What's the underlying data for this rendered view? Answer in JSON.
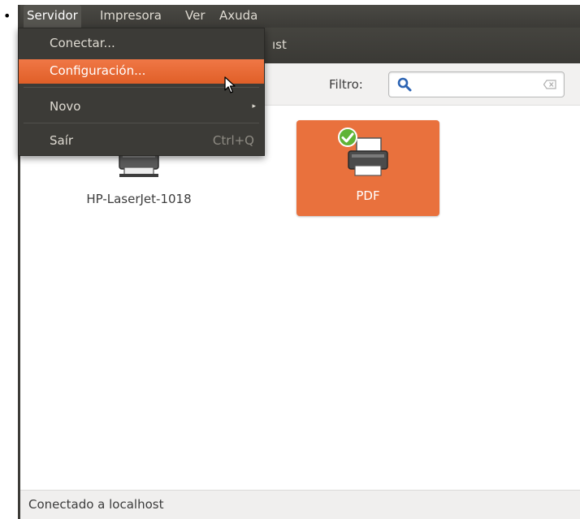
{
  "menubar": {
    "items": [
      {
        "label": "Servidor"
      },
      {
        "label": "Impresora"
      },
      {
        "label": "Ver"
      },
      {
        "label": "Axuda"
      }
    ]
  },
  "window": {
    "title_fragment": "ıst"
  },
  "server_menu": {
    "items": [
      {
        "label": "Conectar..."
      },
      {
        "label": "Configuración..."
      },
      {
        "label": "Novo",
        "submenu_arrow": "▸"
      },
      {
        "label": "Saír",
        "shortcut": "Ctrl+Q"
      }
    ]
  },
  "toolbar": {
    "filter_label": "Filtro:",
    "filter_value": ""
  },
  "printers": [
    {
      "name": "HP-LaserJet-1018",
      "selected": false
    },
    {
      "name": "PDF",
      "selected": true,
      "default": true
    }
  ],
  "statusbar": {
    "text": "Conectado a localhost"
  },
  "colors": {
    "accent": "#e9713d",
    "menubar_bg": "#3c3b37",
    "menu_text": "#dfdbd2",
    "default_check": "#5fb336"
  },
  "icons": [
    "search-icon",
    "clear-icon",
    "printer-icon",
    "default-check-icon",
    "submenu-arrow-icon",
    "mouse-cursor-icon"
  ]
}
